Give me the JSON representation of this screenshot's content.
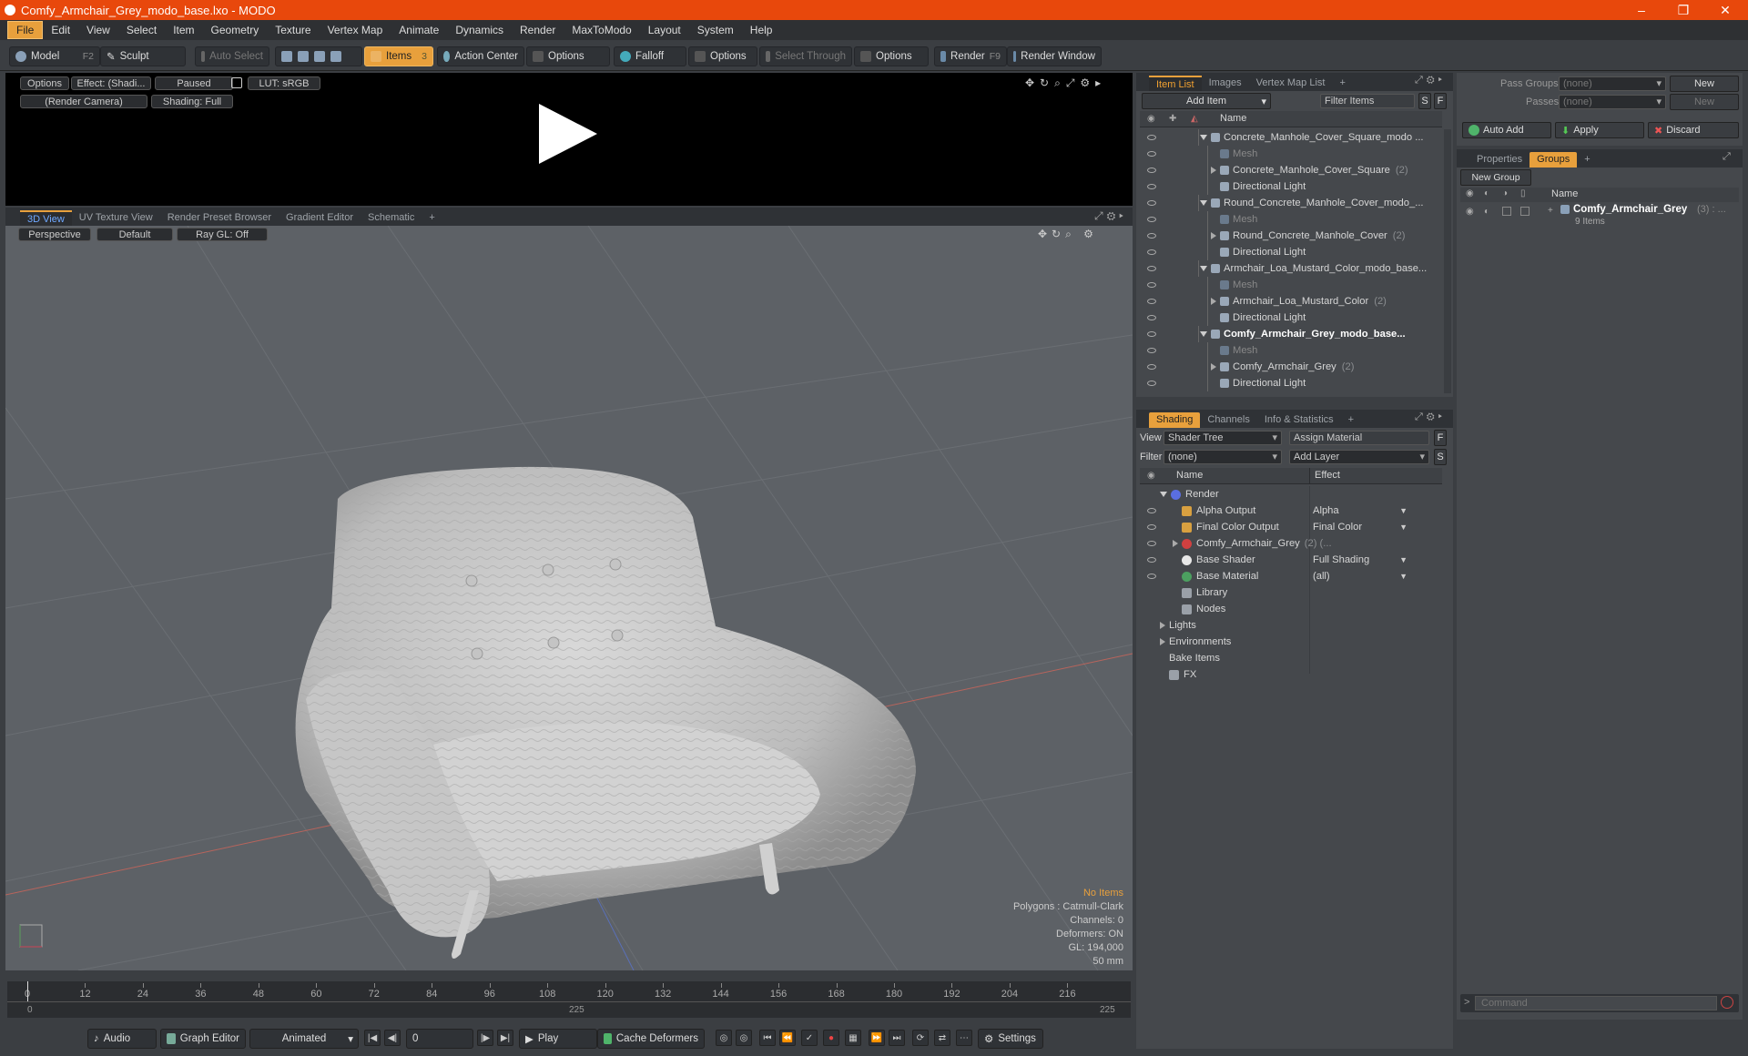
{
  "window": {
    "title": "Comfy_Armchair_Grey_modo_base.lxo - MODO"
  },
  "menu": [
    "File",
    "Edit",
    "View",
    "Select",
    "Item",
    "Geometry",
    "Texture",
    "Vertex Map",
    "Animate",
    "Dynamics",
    "Render",
    "MaxToModo",
    "Layout",
    "System",
    "Help"
  ],
  "toolbar": {
    "model": "Model",
    "model_key": "F2",
    "sculpt": "Sculpt",
    "auto_select": "Auto Select",
    "items": "Items",
    "items_key": "3",
    "action_center": "Action Center",
    "options1": "Options",
    "falloff": "Falloff",
    "options2": "Options",
    "select_through": "Select Through",
    "options3": "Options",
    "render": "Render",
    "render_key": "F9",
    "render_window": "Render Window"
  },
  "preview": {
    "options": "Options",
    "effect": "Effect: (Shadi...",
    "paused": "Paused",
    "lut": "LUT: sRGB",
    "camera": "(Render Camera)",
    "shading": "Shading: Full"
  },
  "viewport_tabs": [
    "3D View",
    "UV Texture View",
    "Render Preset Browser",
    "Gradient Editor",
    "Schematic"
  ],
  "viewport": {
    "perspective": "Perspective",
    "default": "Default",
    "raygl": "Ray GL: Off",
    "info": {
      "no_items": "No Items",
      "polygons": "Polygons : Catmull-Clark",
      "channels": "Channels: 0",
      "deformers": "Deformers: ON",
      "gl": "GL: 194,000",
      "lens": "50 mm"
    }
  },
  "timeline": {
    "labels": [
      "0",
      "12",
      "24",
      "36",
      "48",
      "60",
      "72",
      "84",
      "96",
      "108",
      "120",
      "132",
      "144",
      "156",
      "168",
      "180",
      "192",
      "204",
      "216"
    ],
    "start": "0",
    "mid": "225",
    "end": "225"
  },
  "bottom": {
    "audio": "Audio",
    "graph_editor": "Graph Editor",
    "animated": "Animated",
    "frame": "0",
    "play": "Play",
    "cache_deformers": "Cache Deformers",
    "settings": "Settings"
  },
  "item_list": {
    "tabs": [
      "Item List",
      "Images",
      "Vertex Map List"
    ],
    "add_item": "Add Item",
    "filter_items": "Filter Items",
    "s": "S",
    "f": "F",
    "col_name": "Name",
    "rows": [
      {
        "text": "Concrete_Manhole_Cover_Square_modo ...",
        "indent": 0,
        "expand": "down",
        "count": "",
        "style": "normal"
      },
      {
        "text": "Mesh",
        "indent": 1,
        "expand": "",
        "count": "",
        "style": "dim"
      },
      {
        "text": "Concrete_Manhole_Cover_Square",
        "indent": 1,
        "expand": "right",
        "count": "(2)",
        "style": "normal"
      },
      {
        "text": "Directional Light",
        "indent": 1,
        "expand": "",
        "count": "",
        "style": "normal"
      },
      {
        "text": "Round_Concrete_Manhole_Cover_modo_...",
        "indent": 0,
        "expand": "down",
        "count": "",
        "style": "normal"
      },
      {
        "text": "Mesh",
        "indent": 1,
        "expand": "",
        "count": "",
        "style": "dim"
      },
      {
        "text": "Round_Concrete_Manhole_Cover",
        "indent": 1,
        "expand": "right",
        "count": "(2)",
        "style": "normal"
      },
      {
        "text": "Directional Light",
        "indent": 1,
        "expand": "",
        "count": "",
        "style": "normal"
      },
      {
        "text": "Armchair_Loa_Mustard_Color_modo_base...",
        "indent": 0,
        "expand": "down",
        "count": "",
        "style": "normal"
      },
      {
        "text": "Mesh",
        "indent": 1,
        "expand": "",
        "count": "",
        "style": "dim"
      },
      {
        "text": "Armchair_Loa_Mustard_Color",
        "indent": 1,
        "expand": "right",
        "count": "(2)",
        "style": "normal"
      },
      {
        "text": "Directional Light",
        "indent": 1,
        "expand": "",
        "count": "",
        "style": "normal"
      },
      {
        "text": "Comfy_Armchair_Grey_modo_base...",
        "indent": 0,
        "expand": "down",
        "count": "",
        "style": "bold"
      },
      {
        "text": "Mesh",
        "indent": 1,
        "expand": "",
        "count": "",
        "style": "dim"
      },
      {
        "text": "Comfy_Armchair_Grey",
        "indent": 1,
        "expand": "right",
        "count": "(2)",
        "style": "normal"
      },
      {
        "text": "Directional Light",
        "indent": 1,
        "expand": "",
        "count": "",
        "style": "normal"
      }
    ]
  },
  "shading": {
    "tabs": [
      "Shading",
      "Channels",
      "Info & Statistics"
    ],
    "view_label": "View",
    "view_value": "Shader Tree",
    "assign_material": "Assign Material",
    "f": "F",
    "filter_label": "Filter",
    "filter_value": "(none)",
    "add_layer": "Add Layer",
    "s": "S",
    "col_name": "Name",
    "col_effect": "Effect",
    "rows": [
      {
        "name": "Render",
        "effect": "",
        "indent": 0,
        "expand": "down",
        "eye": false,
        "icon": "sphere-blue"
      },
      {
        "name": "Alpha Output",
        "effect": "Alpha",
        "indent": 1,
        "expand": "",
        "eye": true,
        "icon": "output"
      },
      {
        "name": "Final Color Output",
        "effect": "Final Color",
        "indent": 1,
        "expand": "",
        "eye": true,
        "icon": "output"
      },
      {
        "name": "Comfy_Armchair_Grey",
        "effect": "",
        "count": "(2) (...",
        "indent": 1,
        "expand": "right",
        "eye": true,
        "icon": "material-red"
      },
      {
        "name": "Base Shader",
        "effect": "Full Shading",
        "indent": 1,
        "expand": "",
        "eye": true,
        "icon": "sphere-white"
      },
      {
        "name": "Base Material",
        "effect": "(all)",
        "indent": 1,
        "expand": "",
        "eye": true,
        "icon": "sphere-green"
      },
      {
        "name": "Library",
        "effect": "",
        "indent": 1,
        "expand": "",
        "eye": false,
        "icon": "folder"
      },
      {
        "name": "Nodes",
        "effect": "",
        "indent": 1,
        "expand": "",
        "eye": false,
        "icon": "folder"
      },
      {
        "name": "Lights",
        "effect": "",
        "indent": 0,
        "expand": "right",
        "eye": false,
        "icon": ""
      },
      {
        "name": "Environments",
        "effect": "",
        "indent": 0,
        "expand": "right",
        "eye": false,
        "icon": ""
      },
      {
        "name": "Bake Items",
        "effect": "",
        "indent": 0,
        "expand": "",
        "eye": false,
        "icon": ""
      },
      {
        "name": "FX",
        "effect": "",
        "indent": 0,
        "expand": "",
        "eye": false,
        "icon": "fx"
      }
    ]
  },
  "passes": {
    "pass_groups_label": "Pass Groups",
    "pass_groups_value": "(none)",
    "new1": "New",
    "passes_label": "Passes",
    "passes_value": "(none)",
    "new2": "New",
    "auto_add": "Auto Add",
    "apply": "Apply",
    "discard": "Discard"
  },
  "groups": {
    "tabs": [
      "Properties",
      "Groups"
    ],
    "new_group": "New Group",
    "col_name": "Name",
    "item": "Comfy_Armchair_Grey",
    "item_count": "(3) : ...",
    "sub": "9 Items"
  },
  "command": {
    "placeholder": "Command"
  },
  "colors": {
    "accent": "#e8a03c",
    "titlebar": "#e8480c"
  }
}
